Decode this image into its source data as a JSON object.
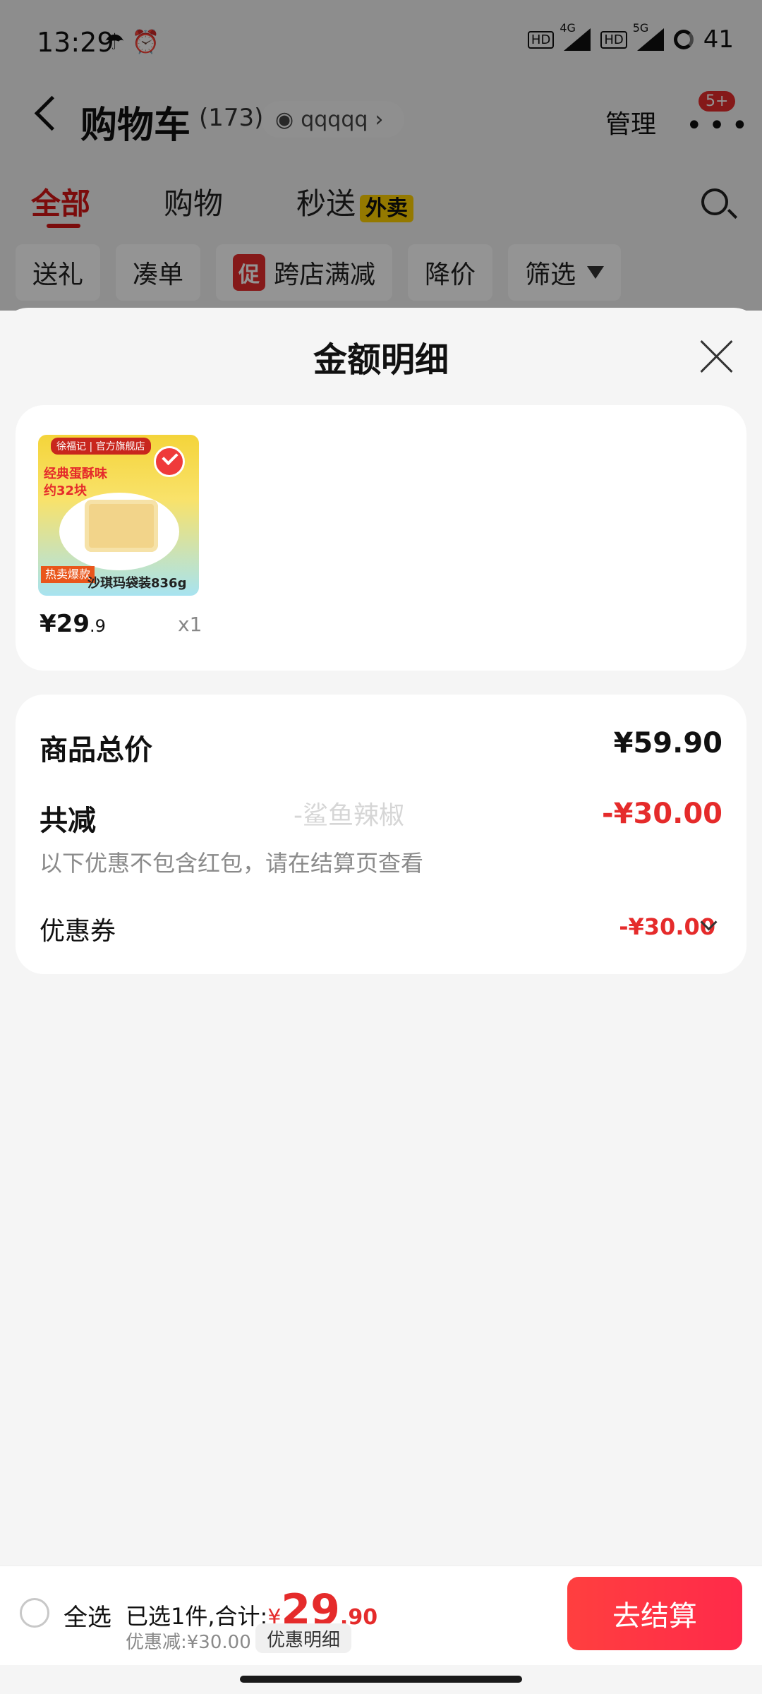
{
  "status_bar": {
    "time": "13:29",
    "network_left": "4G",
    "network_right": "5G",
    "battery": "41"
  },
  "header": {
    "title": "购物车",
    "count": "(173)",
    "user": "qqqqq",
    "manage": "管理",
    "badge": "5+"
  },
  "tabs": [
    {
      "label": "全部"
    },
    {
      "label": "购物"
    },
    {
      "label": "秒送"
    }
  ],
  "tabs_tag": "外卖",
  "chips": [
    "送礼",
    "凑单",
    "跨店满减",
    "降价",
    "筛选"
  ],
  "chip_promo": "促",
  "sheet": {
    "title": "金额明细",
    "item": {
      "price_int": "¥29",
      "price_dec": ".9",
      "qty": "x1",
      "image_text": {
        "brand": "徐福记 | 官方旗舰店",
        "bubble_1": "经典蛋酥味",
        "bubble_2": "约32块",
        "hot": "热卖爆款",
        "name": "沙琪玛袋装836g"
      }
    },
    "total_label": "商品总价",
    "total_value": "¥59.90",
    "reduction_label": "共减",
    "reduction_value": "-¥30.00",
    "reduction_note": "以下优惠不包含红包，请在结算页查看",
    "coupon_label": "优惠券",
    "coupon_value": "-¥30.00",
    "watermark": "-鲨鱼辣椒"
  },
  "bottom": {
    "select_all": "全选",
    "selected_text": "已选1件,合计:",
    "currency": "¥",
    "amount_int": "29",
    "amount_dec": ".90",
    "discount": "优惠减:¥30.00",
    "detail_button": "优惠明细",
    "checkout": "去结算"
  },
  "colors": {
    "accent_red": "#e52b2b",
    "tab_red": "#d41616",
    "takeout_yellow": "#ffd000"
  }
}
